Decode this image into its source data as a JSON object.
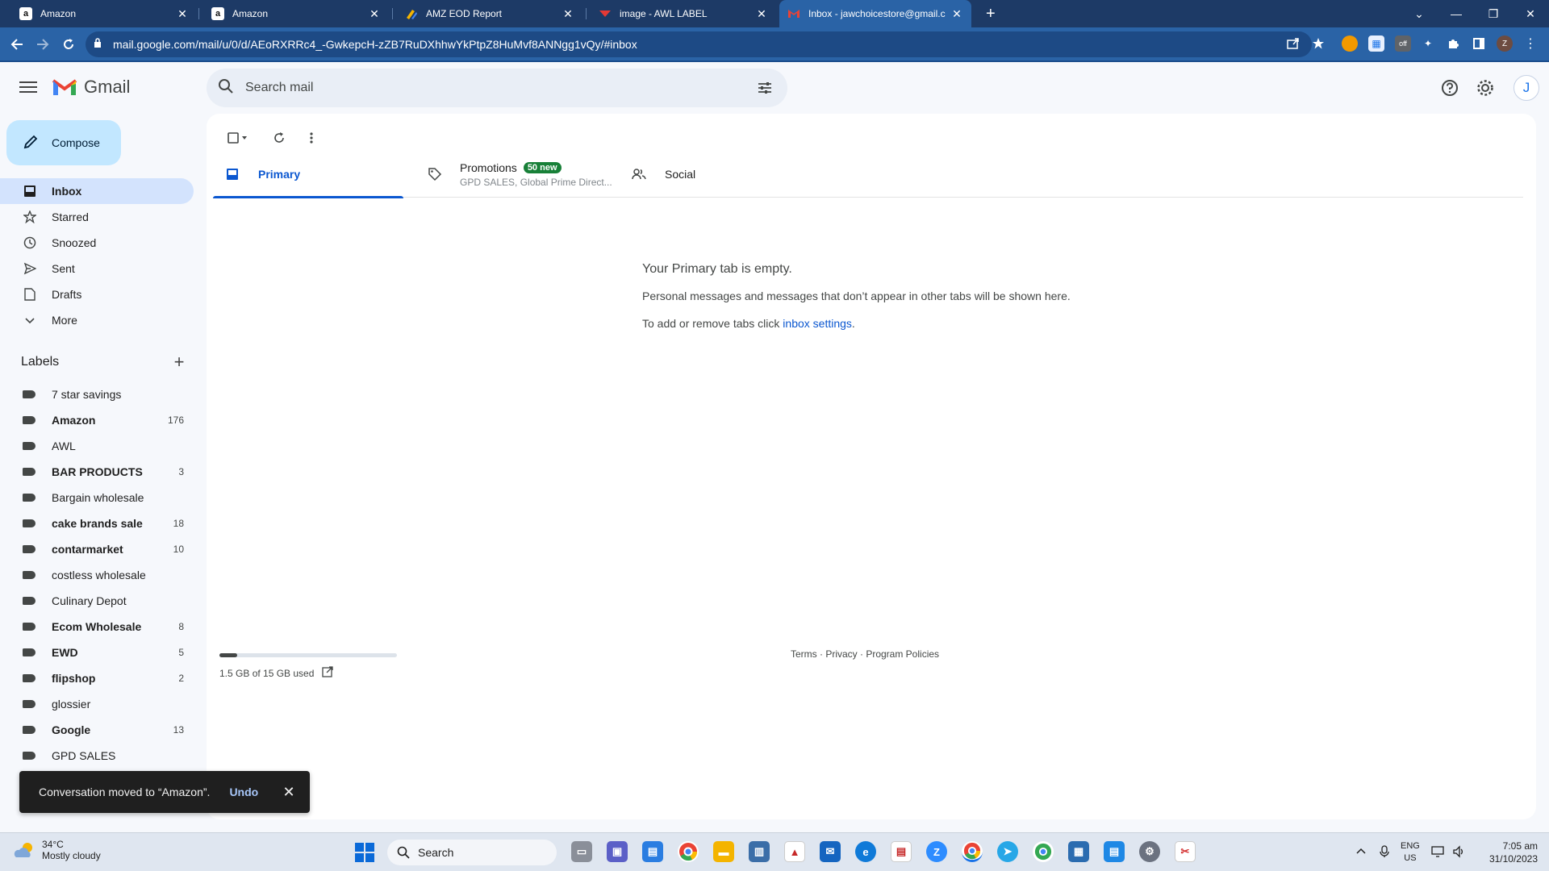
{
  "browser": {
    "tabs": [
      {
        "title": "Amazon",
        "favicon": "a"
      },
      {
        "title": "Amazon",
        "favicon": "a"
      },
      {
        "title": "AMZ EOD Report",
        "favicon": ""
      },
      {
        "title": "image - AWL LABEL",
        "favicon": ""
      },
      {
        "title": "Inbox - jawchoicestore@gmail.c",
        "favicon": "M"
      }
    ],
    "url": "mail.google.com/mail/u/0/d/AEoRXRRc4_-GwkepcH-zZB7RuDXhhwYkPtpZ8HuMvf8ANNgg1vQy/#inbox",
    "profile_initial": "Z"
  },
  "gmail": {
    "logo_text": "Gmail",
    "search_placeholder": "Search mail",
    "avatar_initial": "J",
    "compose_label": "Compose",
    "nav": [
      {
        "label": "Inbox",
        "icon": "inbox-icon"
      },
      {
        "label": "Starred",
        "icon": "star-icon"
      },
      {
        "label": "Snoozed",
        "icon": "clock-icon"
      },
      {
        "label": "Sent",
        "icon": "send-icon"
      },
      {
        "label": "Drafts",
        "icon": "file-icon"
      },
      {
        "label": "More",
        "icon": "chevron-down-icon"
      }
    ],
    "labels_title": "Labels",
    "labels": [
      {
        "name": "7 star savings",
        "count": "",
        "bold": false
      },
      {
        "name": "Amazon",
        "count": "176",
        "bold": true
      },
      {
        "name": "AWL",
        "count": "",
        "bold": false
      },
      {
        "name": "BAR PRODUCTS",
        "count": "3",
        "bold": true
      },
      {
        "name": "Bargain wholesale",
        "count": "",
        "bold": false
      },
      {
        "name": "cake brands sale",
        "count": "18",
        "bold": true
      },
      {
        "name": "contarmarket",
        "count": "10",
        "bold": true
      },
      {
        "name": "costless wholesale",
        "count": "",
        "bold": false
      },
      {
        "name": "Culinary Depot",
        "count": "",
        "bold": false
      },
      {
        "name": "Ecom Wholesale",
        "count": "8",
        "bold": true
      },
      {
        "name": "EWD",
        "count": "5",
        "bold": true
      },
      {
        "name": "flipshop",
        "count": "2",
        "bold": true
      },
      {
        "name": "glossier",
        "count": "",
        "bold": false
      },
      {
        "name": "Google",
        "count": "13",
        "bold": true
      },
      {
        "name": "GPD SALES",
        "count": "",
        "bold": false
      }
    ],
    "tabs": {
      "primary": "Primary",
      "promotions": "Promotions",
      "promotions_badge": "50 new",
      "promotions_sub": "GPD SALES, Global Prime Direct...",
      "social": "Social"
    },
    "empty": {
      "title": "Your Primary tab is empty.",
      "description": "Personal messages and messages that don’t appear in other tabs will be shown here.",
      "hint_prefix": "To add or remove tabs click ",
      "hint_link": "inbox settings",
      "hint_suffix": "."
    },
    "storage": {
      "text": "1.5 GB of 15 GB used",
      "fraction": 0.1
    },
    "footer": "Terms · Privacy · Program Policies",
    "snackbar": {
      "message": "Conversation moved to “Amazon”.",
      "action": "Undo"
    }
  },
  "taskbar": {
    "weather_temp": "34°C",
    "weather_desc": "Mostly cloudy",
    "search_label": "Search",
    "lang_top": "ENG",
    "lang_bottom": "US",
    "time": "7:05 am",
    "date": "31/10/2023"
  },
  "colors": {
    "accent": "#0b57d0",
    "compose_bg": "#c2e7ff",
    "nav_active": "#d3e3fd",
    "browser_tabbar": "#1d3a66",
    "browser_toolbar": "#2a63a6",
    "promo_badge": "#188038"
  }
}
